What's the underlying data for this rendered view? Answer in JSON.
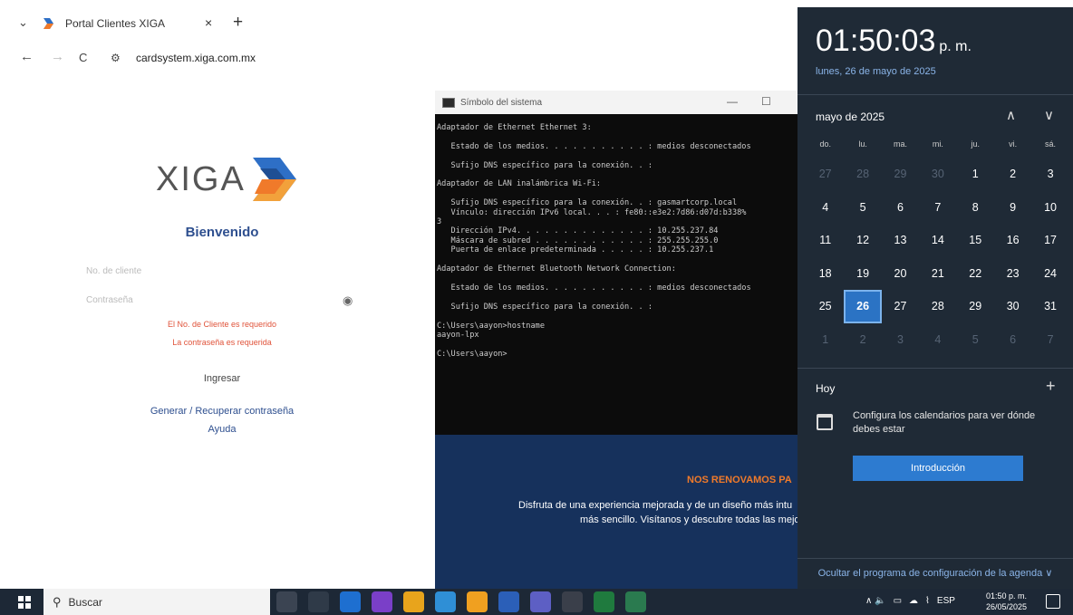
{
  "browser": {
    "tab_title": "Portal Clientes XIGA",
    "tab_close": "×",
    "new_tab": "+",
    "url": "cardsystem.xiga.com.mx",
    "back": "←",
    "forward": "→",
    "reload": "C",
    "chevron": "⌄"
  },
  "login": {
    "logo_text": "XIGA",
    "welcome": "Bienvenido",
    "client_placeholder": "No. de cliente",
    "password_placeholder": "Contraseña",
    "error_client": "El No. de Cliente es requerido",
    "error_password": "La contraseña es requerida",
    "submit": "Ingresar",
    "link_recover": "Generar / Recuperar contraseña",
    "link_help": "Ayuda"
  },
  "cmd": {
    "title": "Símbolo del sistema",
    "minimize": "—",
    "maximize": "☐",
    "output": "Adaptador de Ethernet Ethernet 3:\n\n   Estado de los medios. . . . . . . . . . . : medios desconectados\n\n   Sufijo DNS específico para la conexión. . :\n\nAdaptador de LAN inalámbrica Wi-Fi:\n\n   Sufijo DNS específico para la conexión. . : gasmartcorp.local\n   Vínculo: dirección IPv6 local. . . : fe80::e3e2:7d86:d07d:b338%\n3\n   Dirección IPv4. . . . . . . . . . . . . . : 10.255.237.84\n   Máscara de subred . . . . . . . . . . . . : 255.255.255.0\n   Puerta de enlace predeterminada . . . . . : 10.255.237.1\n\nAdaptador de Ethernet Bluetooth Network Connection:\n\n   Estado de los medios. . . . . . . . . . . : medios desconectados\n\n   Sufijo DNS específico para la conexión. . :\n\nC:\\Users\\aayon>hostname\naayon-lpx\n\nC:\\Users\\aayon>"
  },
  "banner": {
    "title": "NOS RENOVAMOS PA",
    "line1": "Disfruta de una experiencia mejorada y de un diseño más intu",
    "line2": "más sencillo. Visítanos y descubre todas las mejor"
  },
  "calendar": {
    "time": "01:50:03",
    "ampm": "p. m.",
    "full_date": "lunes, 26 de mayo de 2025",
    "month_label": "mayo de 2025",
    "prev": "∧",
    "next": "∨",
    "weekdays": [
      "do.",
      "lu.",
      "ma.",
      "mi.",
      "ju.",
      "vi.",
      "sá."
    ],
    "weeks": [
      [
        {
          "d": "27",
          "o": true
        },
        {
          "d": "28",
          "o": true
        },
        {
          "d": "29",
          "o": true
        },
        {
          "d": "30",
          "o": true
        },
        {
          "d": "1"
        },
        {
          "d": "2"
        },
        {
          "d": "3"
        }
      ],
      [
        {
          "d": "4"
        },
        {
          "d": "5"
        },
        {
          "d": "6"
        },
        {
          "d": "7"
        },
        {
          "d": "8"
        },
        {
          "d": "9"
        },
        {
          "d": "10"
        }
      ],
      [
        {
          "d": "11"
        },
        {
          "d": "12"
        },
        {
          "d": "13"
        },
        {
          "d": "14"
        },
        {
          "d": "15"
        },
        {
          "d": "16"
        },
        {
          "d": "17"
        }
      ],
      [
        {
          "d": "18"
        },
        {
          "d": "19"
        },
        {
          "d": "20"
        },
        {
          "d": "21"
        },
        {
          "d": "22"
        },
        {
          "d": "23"
        },
        {
          "d": "24"
        }
      ],
      [
        {
          "d": "25"
        },
        {
          "d": "26",
          "t": true
        },
        {
          "d": "27"
        },
        {
          "d": "28"
        },
        {
          "d": "29"
        },
        {
          "d": "30"
        },
        {
          "d": "31"
        }
      ],
      [
        {
          "d": "1",
          "o": true
        },
        {
          "d": "2",
          "o": true
        },
        {
          "d": "3",
          "o": true
        },
        {
          "d": "4",
          "o": true
        },
        {
          "d": "5",
          "o": true
        },
        {
          "d": "6",
          "o": true
        },
        {
          "d": "7",
          "o": true
        }
      ]
    ],
    "today_label": "Hoy",
    "add": "+",
    "config_text": "Configura los calendarios para ver dónde debes estar",
    "intro_button": "Introducción",
    "hide_agenda": "Ocultar el programa de configuración de la agenda ∨"
  },
  "taskbar": {
    "search_label": "Buscar",
    "tray_lang": "ESP",
    "tray_symbols": "∧ 🔈",
    "clock_time": "01:50 p. m.",
    "clock_date": "26/05/2025",
    "icon_colors": [
      "#3b4452",
      "#2f3a48",
      "#1e6fd0",
      "#7a3fc8",
      "#e8a41c",
      "#2f8fd6",
      "#f0a020",
      "#2b5fb8",
      "#5d5fc4",
      "#3a3f4a",
      "#1f7a3e",
      "#2a7a4f"
    ]
  },
  "colors": {
    "flyout_bg": "#1f2a36",
    "accent": "#2b73c4",
    "brand_blue": "#2e4f8f",
    "error": "#e0533a",
    "banner_bg": "#16315c"
  }
}
